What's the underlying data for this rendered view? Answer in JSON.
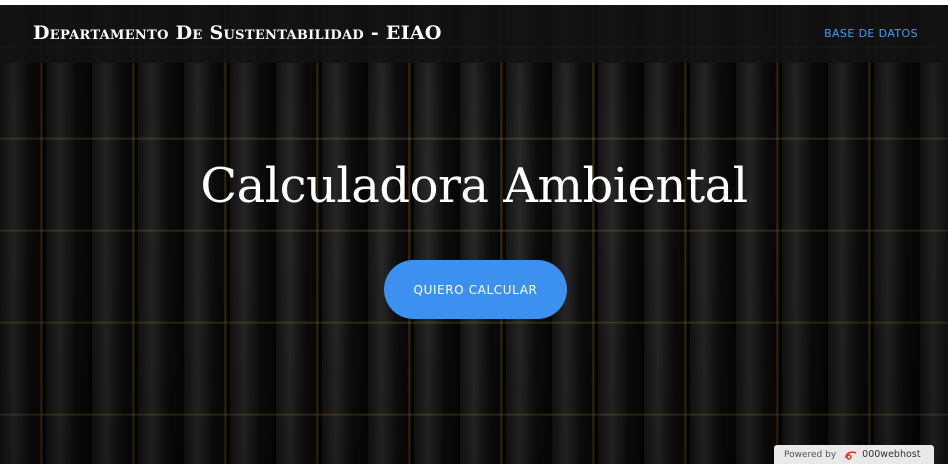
{
  "navbar": {
    "brand": "Departamento De Sustentabilidad - EIAO",
    "link_label": "BASE DE DATOS"
  },
  "hero": {
    "title": "Calculadora Ambiental",
    "button_label": "QUIERO CALCULAR"
  },
  "footer_badge": {
    "prefix": "Powered by",
    "host": "000webhost",
    "icon": "webhost-logo-icon"
  },
  "colors": {
    "accent": "#3c90f0",
    "link": "#4a9bf0",
    "navbar_bg": "#121212",
    "text": "#ffffff"
  }
}
